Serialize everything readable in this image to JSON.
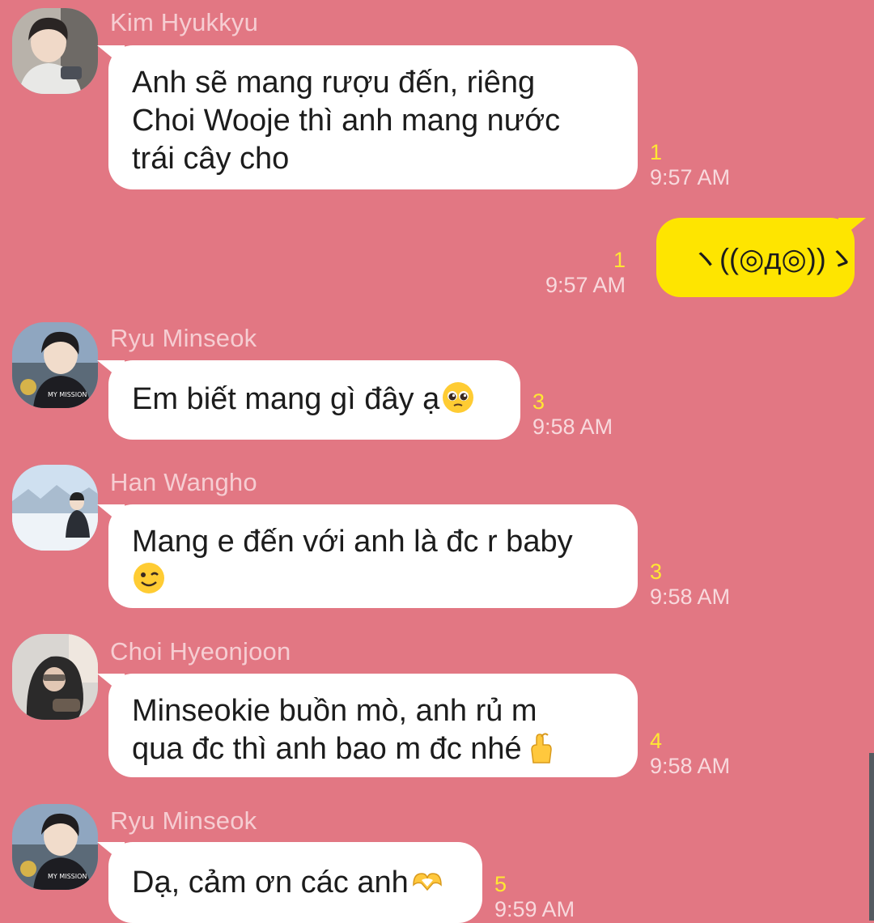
{
  "messages": [
    {
      "sender": "Kim Hyukkyu",
      "lines": [
        "Anh sẽ mang rượu đến, riêng",
        "Choi Wooje thì anh mang nước",
        "trái cây cho"
      ],
      "unread": "1",
      "time": "9:57 AM"
    },
    {
      "mine": true,
      "text": "ヽ((◎д◎))ゝ",
      "unread": "1",
      "time": "9:57 AM"
    },
    {
      "sender": "Ryu Minseok",
      "text": "Em biết mang gì đây ạ",
      "emoji": "pleading-face-emoji",
      "unread": "3",
      "time": "9:58 AM"
    },
    {
      "sender": "Han Wangho",
      "lines": [
        "Mang e đến với anh là đc r baby"
      ],
      "emoji": "winking-face-emoji",
      "unread": "3",
      "time": "9:58 AM"
    },
    {
      "sender": "Choi Hyeonjoon",
      "lines": [
        "Minseokie buồn mò, anh rủ m",
        "qua đc thì anh bao m đc nhé"
      ],
      "emoji": "finger-heart-emoji",
      "unread": "4",
      "time": "9:58 AM"
    },
    {
      "sender": "Ryu Minseok",
      "text": "Dạ, cảm ơn các anh",
      "emoji": "heart-hands-emoji",
      "unread": "5",
      "time": "9:59 AM"
    }
  ],
  "colors": {
    "background": "#e27783",
    "incoming_bubble": "#ffffff",
    "outgoing_bubble": "#fee500",
    "unread_count": "#ffe733"
  }
}
